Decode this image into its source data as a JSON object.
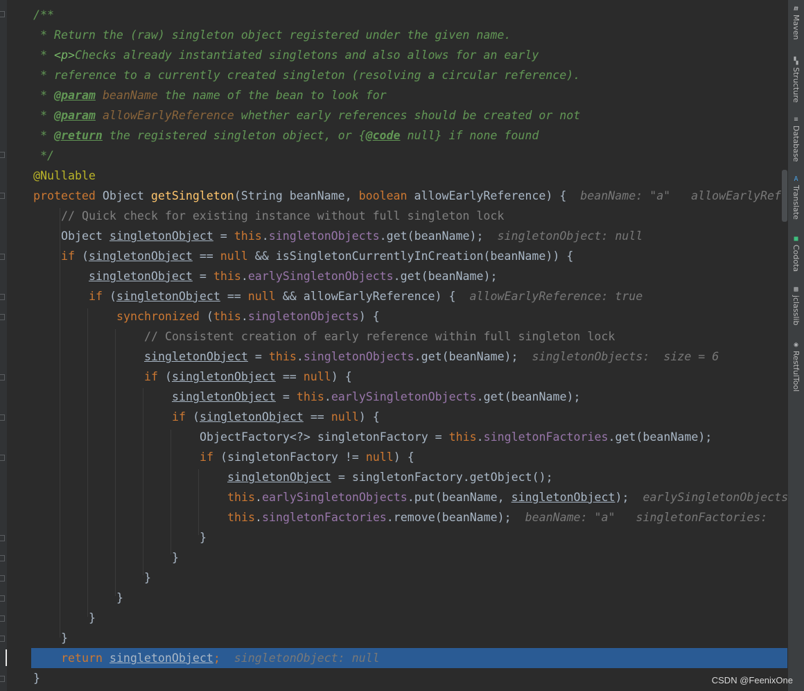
{
  "code": {
    "doc_open": "/**",
    "doc_star": " *",
    "doc_line1": " Return the (raw) singleton object registered under the given name.",
    "doc_p_tag": "<p>",
    "doc_line2": "Checks already instantiated singletons and also allows for an early",
    "doc_line3": " reference to a currently created singleton (resolving a circular reference).",
    "tag_param": "@param",
    "tag_return": "@return",
    "tag_code": "@code",
    "p1_name": "beanName",
    "p1_desc": " the name of the bean to look for",
    "p2_name": "allowEarlyReference",
    "p2_desc": " whether early references should be created or not",
    "ret_desc1": " the registered singleton object, or {",
    "ret_desc2": " null} if none found",
    "doc_close": " */",
    "annotation": "@Nullable",
    "kw_protected": "protected",
    "kw_boolean": "boolean",
    "kw_if": "if",
    "kw_null": "null",
    "kw_this": "this",
    "kw_synchronized": "synchronized",
    "kw_return": "return",
    "type_object": "Object",
    "method_name": "getSingleton",
    "sig_params_1": "(String beanName, ",
    "sig_params_2": " allowEarlyReference) {",
    "hint_sig": "beanName: \"a\"   allowEarlyRef",
    "comment1": "// Quick check for existing instance without full singleton lock",
    "var_so": "singletonObject",
    "field_so": "singletonObjects",
    "field_eso": "earlySingletonObjects",
    "field_sf": "singletonFactories",
    "t_eq": " = ",
    "t_dot": ".",
    "t_get": "get(beanName);",
    "t_get_br": "get(beanName));",
    "hint_so_null": "singletonObject: null",
    "t_ifopen": " (",
    "t_eqeq_null_and": " == ",
    "t_and_iscic": " && isSingletonCurrentlyInCreation(beanName)) {",
    "t_and_aer": " && allowEarlyReference) {",
    "hint_aer": "allowEarlyReference: true",
    "t_sync_open": " (",
    "t_sync_close": ") {",
    "comment2": "// Consistent creation of early reference within full singleton lock",
    "hint_size": "singletonObjects:  size = 6",
    "t_null_close": ") {",
    "t_of_decl": "ObjectFactory<?> singletonFactory = ",
    "t_if_sf": " (singletonFactory != ",
    "t_getobject": "singletonFactory.getObject();",
    "t_put_open": "put(beanName, ",
    "t_put_close": ");",
    "hint_eso": "earlySingletonObjects",
    "t_remove": "remove(beanName);",
    "hint_remove": "beanName: \"a\"   singletonFactories:",
    "brace_close": "}",
    "t_semicolon": ";"
  },
  "sidebar": {
    "maven": "Maven",
    "maven_icon": "m",
    "structure": "Structure",
    "database": "Database",
    "translate": "Translate",
    "codota": "Codota",
    "jclasslib": "jclasslib",
    "restfultool": "RestfulTool"
  },
  "watermark": "CSDN @FeenixOne",
  "colors": {
    "background": "#2b2b2b",
    "keyword": "#cc7832",
    "doc_comment": "#629755",
    "field": "#9876aa",
    "method": "#ffc66d",
    "annotation": "#bbb529",
    "hint": "#787878",
    "current_line": "#2a5b94"
  }
}
